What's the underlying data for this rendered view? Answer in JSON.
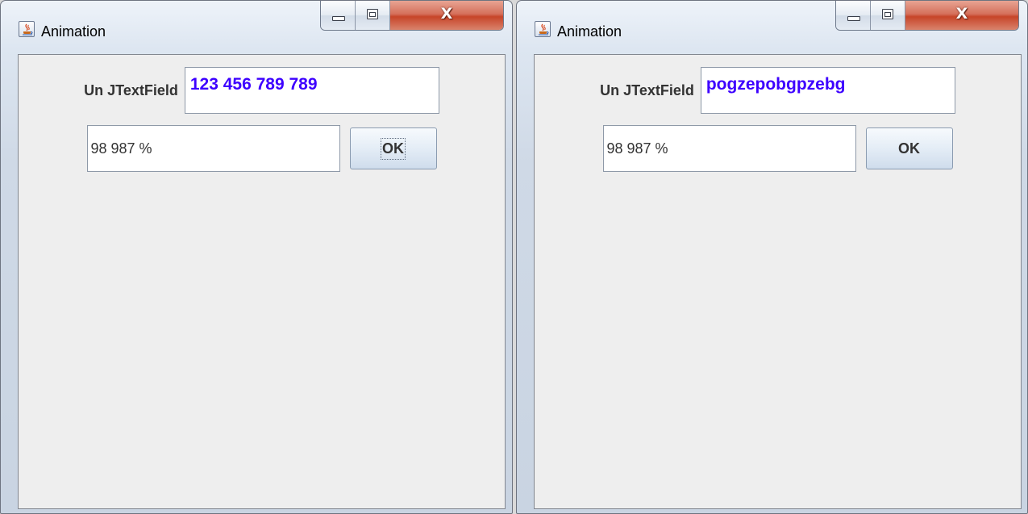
{
  "windows": [
    {
      "title": "Animation",
      "label": "Un JTextField",
      "text_value": "123 456 789 789",
      "formatted_value": "98 987 %",
      "ok_label": "OK",
      "close_glyph": "X"
    },
    {
      "title": "Animation",
      "label": "Un JTextField",
      "text_value": "pogzepobgpzebg",
      "formatted_value": "98 987 %",
      "ok_label": "OK",
      "close_glyph": "X"
    }
  ],
  "icons": {
    "app": "java-coffee-icon",
    "minimize": "minimize-icon",
    "maximize": "maximize-icon",
    "close": "close-icon"
  },
  "colors": {
    "text_field_foreground": "#3d00ff",
    "client_background": "#eeeeee",
    "close_button": "#c74529"
  }
}
